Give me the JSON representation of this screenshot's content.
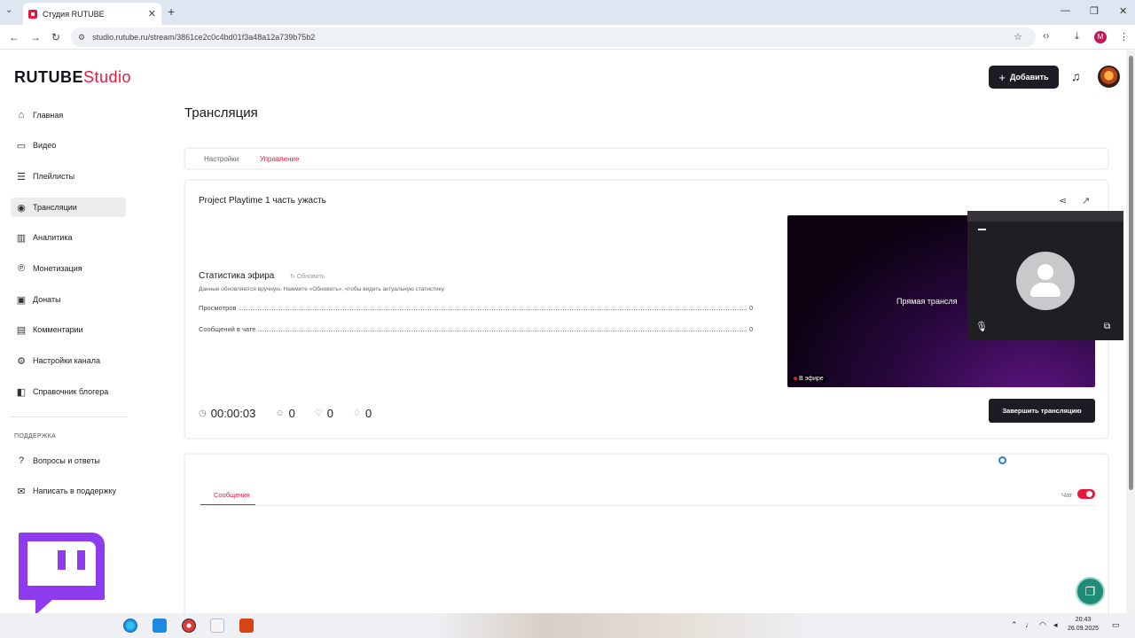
{
  "browser": {
    "tab_title": "Студия RUTUBE",
    "tab_close": "✕",
    "new_tab": "+",
    "url": "studio.rutube.ru/stream/3861ce2c0c4bd01f3a48a12a739b75b2",
    "profile_initial": "M"
  },
  "app": {
    "logo_main": "RUTUBE",
    "logo_studio": "Studio",
    "add_label": "Добавить",
    "page_title": "Трансляция"
  },
  "sidebar": {
    "items": [
      {
        "label": "Главная",
        "icon": "home-icon"
      },
      {
        "label": "Видео",
        "icon": "video-icon"
      },
      {
        "label": "Плейлисты",
        "icon": "playlist-icon"
      },
      {
        "label": "Трансляции",
        "icon": "broadcast-icon"
      },
      {
        "label": "Аналитика",
        "icon": "analytics-icon"
      },
      {
        "label": "Монетизация",
        "icon": "monetization-icon"
      },
      {
        "label": "Донаты",
        "icon": "donate-icon"
      },
      {
        "label": "Комментарии",
        "icon": "comments-icon"
      },
      {
        "label": "Настройки канала",
        "icon": "gear-icon"
      },
      {
        "label": "Справочник блогера",
        "icon": "guide-icon"
      }
    ],
    "support_heading": "ПОДДЕРЖКА",
    "support_items": [
      {
        "label": "Вопросы и ответы",
        "icon": "faq-icon"
      },
      {
        "label": "Написать в поддержку",
        "icon": "mail-icon"
      }
    ]
  },
  "page_tabs": {
    "settings": "Настройки",
    "management": "Управление"
  },
  "stream": {
    "title": "Project Playtime 1 часть ужасть",
    "stats_title": "Статистика эфира",
    "refresh_label": "Обновить",
    "stats_note": "Данные обновляются вручную. Нажмите «Обновить», чтобы видеть актуальную статистику",
    "stats": [
      {
        "label": "Просмотров",
        "value": "0"
      },
      {
        "label": "Сообщений в чате",
        "value": "0"
      }
    ],
    "timer": "00:00:03",
    "viewers": "0",
    "likes": "0",
    "dislikes": "0",
    "player_text": "Прямая трансля",
    "live_badge": "В эфире",
    "end_button": "Завершить трансляцию"
  },
  "chat": {
    "tab_label": "Сообщения",
    "toggle_label": "Чат",
    "enabled": true
  },
  "taskbar": {
    "time": "20:43",
    "date": "26.09.2025"
  },
  "colors": {
    "accent": "#e8173e",
    "dark_button": "#1c1c24",
    "twitch": "#8f3cf0",
    "help_fab": "#1f8c78"
  }
}
